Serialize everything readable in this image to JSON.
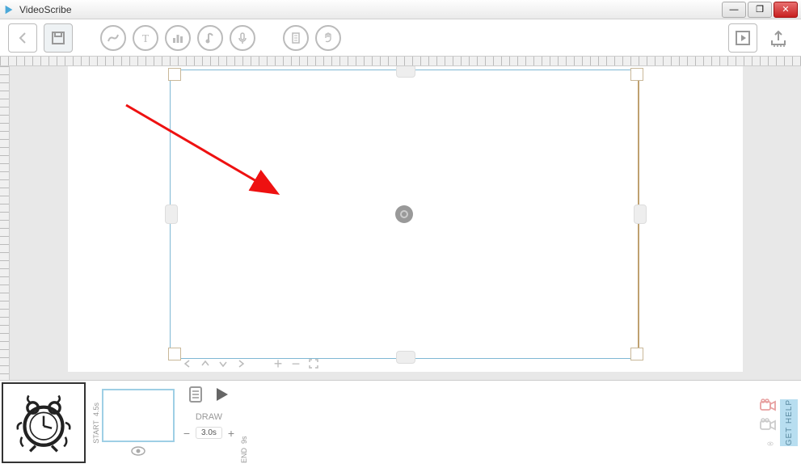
{
  "window": {
    "title": "VideoScribe",
    "minimize": "—",
    "maximize": "❐",
    "close": "✕"
  },
  "toolbar": {
    "back": "back",
    "save": "save",
    "image": "add-image",
    "text": "add-text",
    "chart": "add-chart",
    "music": "add-music",
    "mic": "add-voiceover",
    "paper": "paper-options",
    "hand": "hand-options",
    "play": "preview",
    "export": "export"
  },
  "nav": {
    "first": "«",
    "prev": "‹",
    "down": "⌄",
    "next": "›",
    "plus": "+",
    "minus": "−",
    "fit": "⤢"
  },
  "timeline": {
    "start_label": "START",
    "start_time": "4.5s",
    "draw_label": "DRAW",
    "duration": "3.0s",
    "end_label": "END",
    "end_time": "9s",
    "help": "GET HELP"
  }
}
